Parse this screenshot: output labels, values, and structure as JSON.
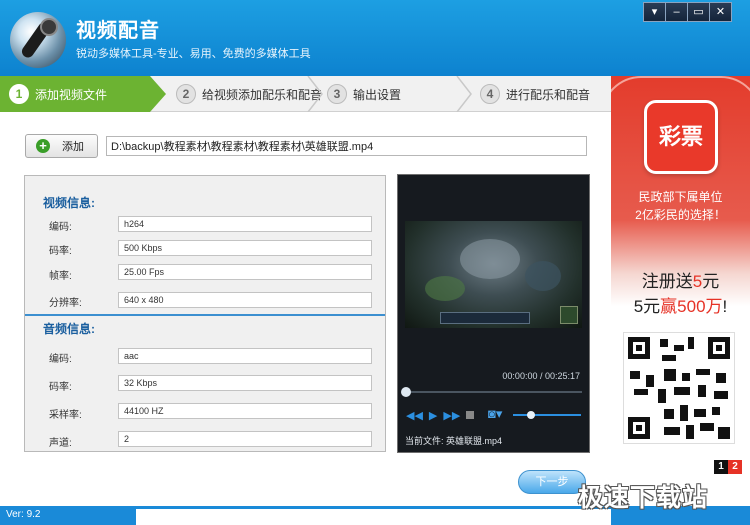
{
  "app": {
    "title": "视频配音",
    "subtitle": "锐动多媒体工具-专业、易用、免费的多媒体工具"
  },
  "window_controls": {
    "menu": "▾",
    "minimize": "–",
    "restore": "▭",
    "close": "✕"
  },
  "steps": [
    {
      "num": "1",
      "label": "添加视频文件"
    },
    {
      "num": "2",
      "label": "给视频添加配乐和配音"
    },
    {
      "num": "3",
      "label": "输出设置"
    },
    {
      "num": "4",
      "label": "进行配乐和配音"
    }
  ],
  "toolbar": {
    "add_label": "添加",
    "file_path": "D:\\backup\\教程素材\\教程素材\\教程素材\\英雄联盟.mp4"
  },
  "video_info": {
    "heading": "视频信息:",
    "fields": [
      {
        "label": "编码:",
        "value": "h264"
      },
      {
        "label": "码率:",
        "value": "500 Kbps"
      },
      {
        "label": "帧率:",
        "value": "25.00 Fps"
      },
      {
        "label": "分辨率:",
        "value": "640 x 480"
      }
    ]
  },
  "audio_info": {
    "heading": "音频信息:",
    "fields": [
      {
        "label": "编码:",
        "value": "aac"
      },
      {
        "label": "码率:",
        "value": "32 Kbps"
      },
      {
        "label": "采样率:",
        "value": "44100 HZ"
      },
      {
        "label": "声道:",
        "value": "2"
      }
    ]
  },
  "player": {
    "time": "00:00:00 / 00:25:17",
    "current_file": "当前文件: 英雄联盟.mp4"
  },
  "next_button": "下一步",
  "ad": {
    "logo_text": "彩票",
    "line1": "民政部下属单位",
    "line2": "2亿彩民的选择！",
    "big1_prefix": "注册送",
    "big1_highlight": "5",
    "big1_suffix": "元",
    "big2_prefix": "5元",
    "big2_highlight": "赢500万",
    "big2_suffix": "!",
    "page1": "1",
    "page2": "2"
  },
  "status": {
    "version": "Ver: 9.2"
  },
  "watermark": "极速下载站",
  "colors": {
    "header_blue": "#0d82cf",
    "step_active_green": "#6cb332",
    "section_heading_blue": "#1b5f9f",
    "ad_red": "#e63226"
  }
}
